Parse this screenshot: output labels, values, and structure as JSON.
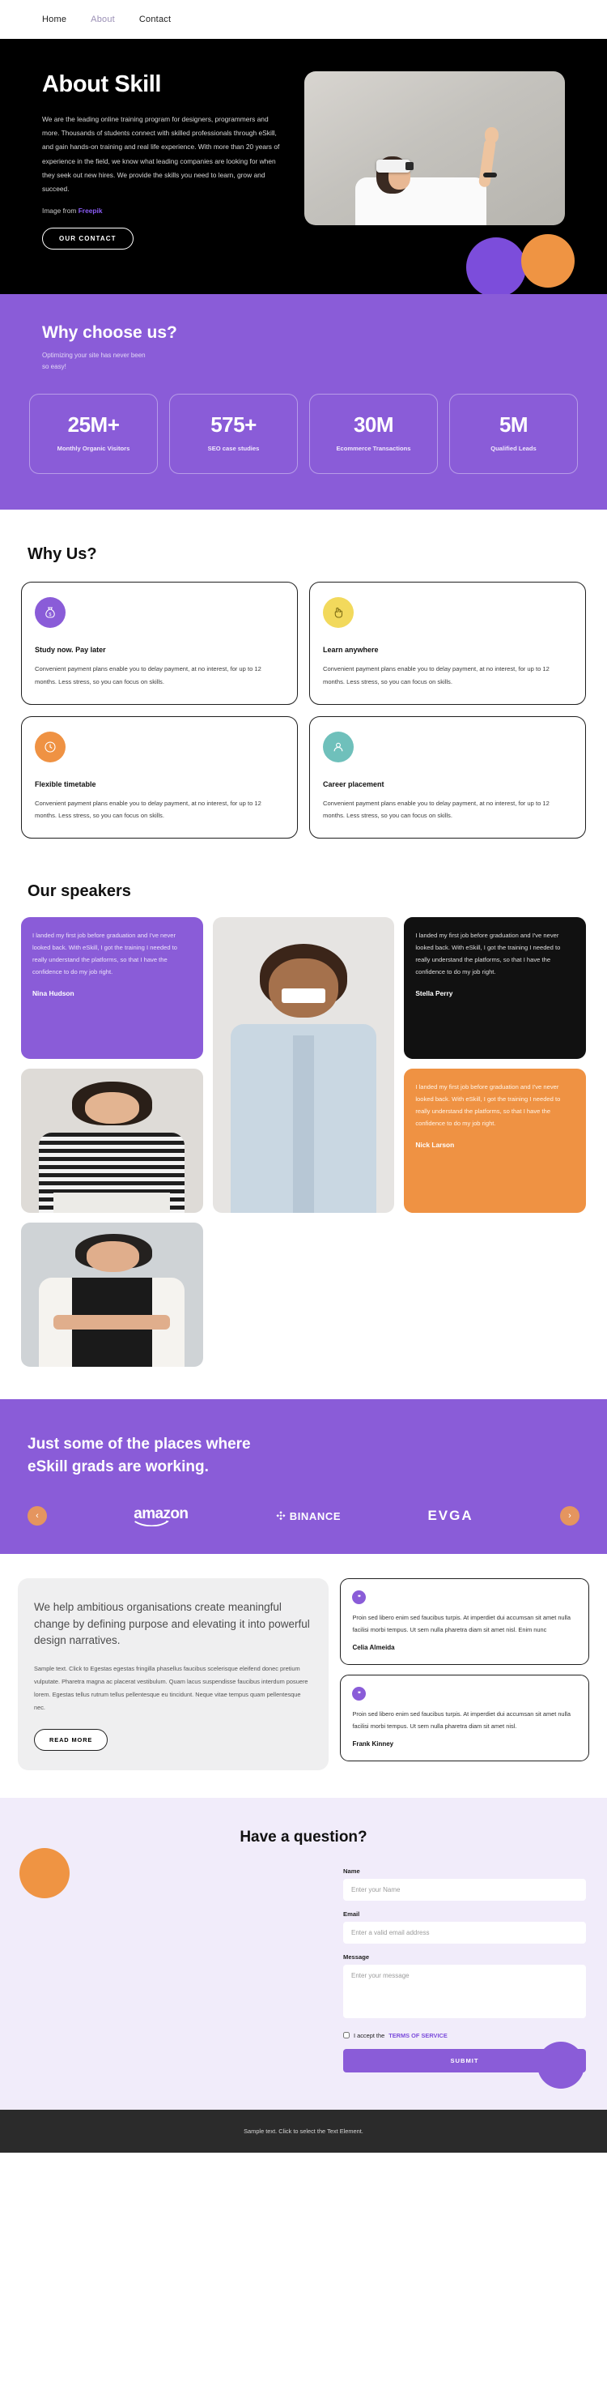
{
  "nav": {
    "items": [
      {
        "label": "Home",
        "active": false
      },
      {
        "label": "About",
        "active": true
      },
      {
        "label": "Contact",
        "active": false
      }
    ]
  },
  "hero": {
    "title": "About Skill",
    "body": "We are the leading online training program for designers, programmers and more. Thousands of students connect with skilled professionals through eSkill, and gain hands-on training and real life experience. With more than 20 years of experience in the field, we know what leading companies are looking for when they seek out new hires. We provide the skills you need to learn, grow and succeed.",
    "credit_prefix": "Image from ",
    "credit_link": "Freepik",
    "cta": "OUR CONTACT",
    "accent": "#8b5cf6"
  },
  "stats": {
    "heading": "Why choose us?",
    "subheading": "Optimizing your site has never been so easy!",
    "bg": "#8a5cd8",
    "items": [
      {
        "value": "25M+",
        "label": "Monthly Organic Visitors"
      },
      {
        "value": "575+",
        "label": "SEO case studies"
      },
      {
        "value": "30M",
        "label": "Ecommerce Transactions"
      },
      {
        "value": "5M",
        "label": "Qualified Leads"
      }
    ]
  },
  "whyus": {
    "heading": "Why Us?",
    "cards": [
      {
        "icon": "money-bag-icon",
        "icon_bg": "#8a5cd8",
        "icon_glyph": "$",
        "title": "Study now. Pay later",
        "text": "Convenient payment plans enable you to delay payment, at no interest, for up to 12 months. Less stress, so you can focus on skills."
      },
      {
        "icon": "hand-tap-icon",
        "icon_bg": "#f2d95c",
        "icon_glyph": "☝",
        "title": "Learn anywhere",
        "text": "Convenient payment plans enable you to delay payment, at no interest, for up to 12 months. Less stress, so you can focus on skills."
      },
      {
        "icon": "clock-icon",
        "icon_bg": "#ef9243",
        "icon_glyph": "◷",
        "title": "Flexible timetable",
        "text": "Convenient payment plans enable you to delay payment, at no interest, for up to 12 months. Less stress, so you can focus on skills."
      },
      {
        "icon": "user-circle-icon",
        "icon_bg": "#6fc0bb",
        "icon_glyph": "☻",
        "title": "Career placement",
        "text": "Convenient payment plans enable you to delay payment, at no interest, for up to 12 months. Less stress, so you can focus on skills."
      }
    ]
  },
  "speakers": {
    "heading": "Our speakers",
    "quote_text": "I landed my first job before graduation and I've never looked back. With eSkill, I got the training I needed to really understand the platforms, so that I have the confidence to do my job right.",
    "quotes": [
      {
        "name": "Nina Hudson",
        "style": "purple"
      },
      {
        "name": "Stella Perry",
        "style": "black"
      },
      {
        "name": "Nick Larson",
        "style": "orange"
      }
    ]
  },
  "brands": {
    "heading": "Just some of the places where eSkill grads are working.",
    "prev_icon": "chevron-left-icon",
    "next_icon": "chevron-right-icon",
    "logos": [
      "amazon",
      "BINANCE",
      "EVGA"
    ]
  },
  "org": {
    "headline": "We help ambitious organisations create meaningful change by defining purpose and elevating it into powerful design narratives.",
    "body": "Sample text. Click to Egestas egestas fringilla phasellus faucibus scelerisque eleifend donec pretium vulputate. Pharetra magna ac placerat vestibulum. Quam lacus suspendisse faucibus interdum posuere lorem. Egestas tellus rutrum tellus pellentesque eu tincidunt. Neque vitae tempus quam pellentesque nec.",
    "read_more": "READ MORE",
    "testimonials": [
      {
        "avatar": "quote-icon",
        "text": "Proin sed libero enim sed faucibus turpis. At imperdiet dui accumsan sit amet nulla facilisi morbi tempus. Ut sem nulla pharetra diam sit amet nisl. Enim nunc",
        "name": "Celia Almeida"
      },
      {
        "avatar": "quote-icon",
        "text": "Proin sed libero enim sed faucibus turpis. At imperdiet dui accumsan sit amet nulla facilisi morbi tempus. Ut sem nulla pharetra diam sit amet nisl.",
        "name": "Frank Kinney"
      }
    ]
  },
  "form": {
    "heading": "Have a question?",
    "name_label": "Name",
    "name_placeholder": "Enter your Name",
    "email_label": "Email",
    "email_placeholder": "Enter a valid email address",
    "message_label": "Message",
    "message_placeholder": "Enter your message",
    "accept_text": "I accept the ",
    "terms_link": "TERMS OF SERVICE",
    "submit": "SUBMIT"
  },
  "footer": {
    "text": "Sample text. Click to select the Text Element."
  }
}
